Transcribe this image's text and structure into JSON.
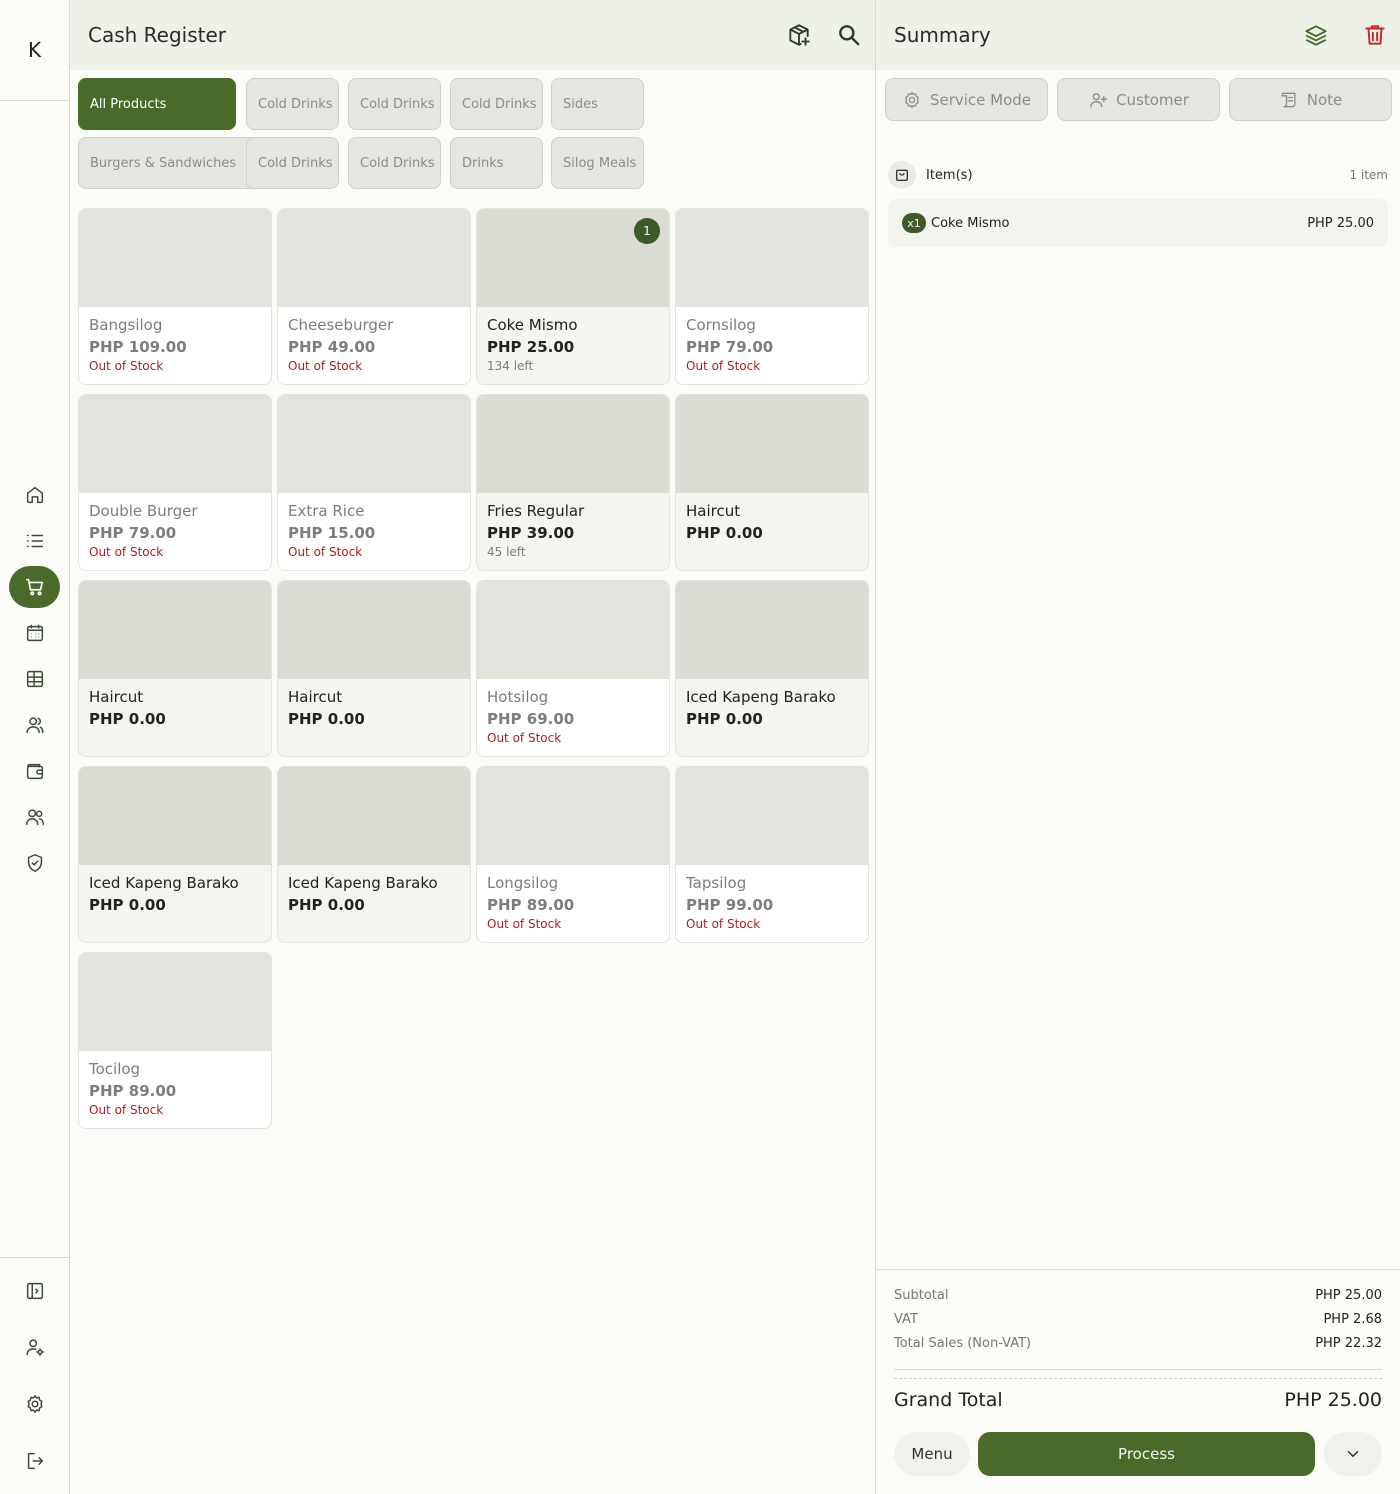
{
  "rail": {
    "logo": "K",
    "nav": [
      {
        "name": "home-icon"
      },
      {
        "name": "list-icon"
      },
      {
        "name": "cart-icon",
        "active": true
      },
      {
        "name": "calendar-icon"
      },
      {
        "name": "table-icon"
      },
      {
        "name": "users-icon"
      },
      {
        "name": "wallet-icon"
      },
      {
        "name": "people-icon"
      },
      {
        "name": "shield-icon"
      }
    ],
    "bottom": [
      {
        "name": "sidebar-toggle-icon"
      },
      {
        "name": "user-settings-icon"
      },
      {
        "name": "gear-icon"
      },
      {
        "name": "logout-icon"
      }
    ]
  },
  "main": {
    "title": "Cash Register",
    "categories": [
      {
        "label": "All Products",
        "active": true
      },
      {
        "label": "Cold Drinks"
      },
      {
        "label": "Cold Drinks"
      },
      {
        "label": "Cold Drinks"
      },
      {
        "label": "Sides"
      },
      {
        "label": "Burgers & Sandwiches"
      },
      {
        "label": "Cold Drinks"
      },
      {
        "label": "Cold Drinks"
      },
      {
        "label": "Drinks"
      },
      {
        "label": "Silog Meals"
      }
    ],
    "products": [
      {
        "name": "Bangsilog",
        "price": "PHP 109.00",
        "stock": "Out of Stock",
        "available": false
      },
      {
        "name": "Cheeseburger",
        "price": "PHP 49.00",
        "stock": "Out of Stock",
        "available": false
      },
      {
        "name": "Coke Mismo",
        "price": "PHP 25.00",
        "stock": "134 left",
        "available": true,
        "badge": "1"
      },
      {
        "name": "Cornsilog",
        "price": "PHP 79.00",
        "stock": "Out of Stock",
        "available": false
      },
      {
        "name": "Double Burger",
        "price": "PHP 79.00",
        "stock": "Out of Stock",
        "available": false
      },
      {
        "name": "Extra Rice",
        "price": "PHP 15.00",
        "stock": "Out of Stock",
        "available": false
      },
      {
        "name": "Fries Regular",
        "price": "PHP 39.00",
        "stock": "45 left",
        "available": true
      },
      {
        "name": "Haircut",
        "price": "PHP 0.00",
        "stock": "",
        "available": true
      },
      {
        "name": "Haircut",
        "price": "PHP 0.00",
        "stock": "",
        "available": true
      },
      {
        "name": "Haircut",
        "price": "PHP 0.00",
        "stock": "",
        "available": true
      },
      {
        "name": "Hotsilog",
        "price": "PHP 69.00",
        "stock": "Out of Stock",
        "available": false
      },
      {
        "name": "Iced Kapeng Barako",
        "price": "PHP 0.00",
        "stock": "",
        "available": true
      },
      {
        "name": "Iced Kapeng Barako",
        "price": "PHP 0.00",
        "stock": "",
        "available": true
      },
      {
        "name": "Iced Kapeng Barako",
        "price": "PHP 0.00",
        "stock": "",
        "available": true
      },
      {
        "name": "Longsilog",
        "price": "PHP 89.00",
        "stock": "Out of Stock",
        "available": false
      },
      {
        "name": "Tapsilog",
        "price": "PHP 99.00",
        "stock": "Out of Stock",
        "available": false
      },
      {
        "name": "Tocilog",
        "price": "PHP 89.00",
        "stock": "Out of Stock",
        "available": false
      }
    ]
  },
  "summary": {
    "title": "Summary",
    "service_mode": "Service Mode",
    "customer": "Customer",
    "note": "Note",
    "items_label": "Item(s)",
    "items_count": "1 item",
    "lines": [
      {
        "qty": "x1",
        "name": "Coke Mismo",
        "price": "PHP 25.00"
      }
    ],
    "subtotal_label": "Subtotal",
    "subtotal": "PHP 25.00",
    "vat_label": "VAT",
    "vat": "PHP 2.68",
    "nonvat_label": "Total Sales (Non-VAT)",
    "nonvat": "PHP 22.32",
    "grand_label": "Grand Total",
    "grand": "PHP 25.00",
    "menu_label": "Menu",
    "process_label": "Process"
  },
  "colors": {
    "accent": "#4a6a2a",
    "danger": "#c0282d",
    "header_bg": "#edf1e8"
  }
}
